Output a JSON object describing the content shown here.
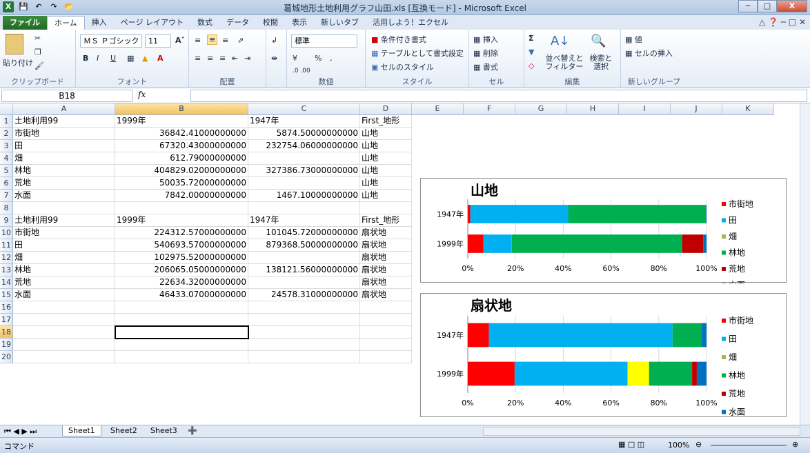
{
  "window": {
    "title": "葛城地形土地利用グラフ山田.xls [互換モード] - Microsoft Excel",
    "buttons": [
      "─",
      "□",
      "X"
    ]
  },
  "ribbon_tabs": [
    "ファイル",
    "ホーム",
    "挿入",
    "ページ レイアウト",
    "数式",
    "データ",
    "校閲",
    "表示",
    "新しいタブ",
    "活用しよう！エクセル"
  ],
  "ribbon": {
    "clipboard": {
      "paste": "貼り付け",
      "label": "クリップボード"
    },
    "font": {
      "name": "ＭＳ Ｐゴシック",
      "size": "11",
      "label": "フォント",
      "bold": "B",
      "italic": "I",
      "underline": "U"
    },
    "alignment": {
      "label": "配置"
    },
    "number": {
      "format": "標準",
      "percent": "%",
      "comma": ",",
      "label": "数値"
    },
    "styles": {
      "cond": "条件付き書式",
      "table": "テーブルとして書式設定",
      "cell": "セルのスタイル",
      "label": "スタイル"
    },
    "cells": {
      "insert": "挿入",
      "delete": "削除",
      "format": "書式",
      "label": "セル"
    },
    "editing": {
      "sigma": "Σ",
      "sort": "並べ替えと フィルター",
      "find": "検索と 選択",
      "label": "編集"
    },
    "custom": {
      "item1": "値",
      "item2": "セルの挿入",
      "label": "新しいグループ"
    }
  },
  "formula_bar": {
    "name_box": "B18",
    "fx": "fx",
    "value": ""
  },
  "columns": [
    "A",
    "B",
    "C",
    "D",
    "E",
    "F",
    "G",
    "H",
    "I",
    "J",
    "K"
  ],
  "rows": [
    "1",
    "2",
    "3",
    "4",
    "5",
    "6",
    "7",
    "8",
    "9",
    "10",
    "11",
    "12",
    "13",
    "14",
    "15",
    "16",
    "17",
    "18",
    "19",
    "20"
  ],
  "cells": [
    [
      "土地利用99",
      "1999年",
      "1947年",
      "First_地形"
    ],
    [
      "市街地",
      "36842.41000000000",
      "5874.50000000000",
      "山地"
    ],
    [
      "田",
      "67320.43000000000",
      "232754.06000000000",
      "山地"
    ],
    [
      "畑",
      "612.79000000000",
      "",
      "山地"
    ],
    [
      "林地",
      "404829.02000000000",
      "327386.73000000000",
      "山地"
    ],
    [
      "荒地",
      "50035.72000000000",
      "",
      "山地"
    ],
    [
      "水面",
      "7842.00000000000",
      "1467.10000000000",
      "山地"
    ],
    [
      "",
      "",
      "",
      ""
    ],
    [
      "土地利用99",
      "1999年",
      "1947年",
      "First_地形"
    ],
    [
      "市街地",
      "224312.57000000000",
      "101045.72000000000",
      "扇状地"
    ],
    [
      "田",
      "540693.57000000000",
      "879368.50000000000",
      "扇状地"
    ],
    [
      "畑",
      "102975.52000000000",
      "",
      "扇状地"
    ],
    [
      "林地",
      "206065.05000000000",
      "138121.56000000000",
      "扇状地"
    ],
    [
      "荒地",
      "22634.32000000000",
      "",
      "扇状地"
    ],
    [
      "水面",
      "46433.07000000000",
      "24578.31000000000",
      "扇状地"
    ]
  ],
  "chart_data": [
    {
      "type": "bar",
      "stacked": "100%",
      "title": "山地",
      "categories": [
        "1947年",
        "1999年"
      ],
      "series": [
        {
          "name": "市街地",
          "color": "#ff0000",
          "values": [
            5874.5,
            36842.41
          ]
        },
        {
          "name": "田",
          "color": "#00b0f0",
          "values": [
            232754.06,
            67320.43
          ]
        },
        {
          "name": "畑",
          "color": "#9bbb59",
          "values": [
            0,
            612.79
          ]
        },
        {
          "name": "林地",
          "color": "#00b050",
          "values": [
            327386.73,
            404829.02
          ]
        },
        {
          "name": "荒地",
          "color": "#c00000",
          "values": [
            0,
            50035.72
          ]
        },
        {
          "name": "水面",
          "color": "#0070c0",
          "values": [
            1467.1,
            7842.0
          ]
        }
      ],
      "xticks": [
        "0%",
        "20%",
        "40%",
        "60%",
        "80%",
        "100%"
      ],
      "legend": "right"
    },
    {
      "type": "bar",
      "stacked": "100%",
      "title": "扇状地",
      "categories": [
        "1947年",
        "1999年"
      ],
      "series": [
        {
          "name": "市街地",
          "color": "#ff0000",
          "values": [
            101045.72,
            224312.57
          ]
        },
        {
          "name": "田",
          "color": "#00b0f0",
          "values": [
            879368.5,
            540693.57
          ]
        },
        {
          "name": "畑",
          "color": "#ffff00",
          "values": [
            0,
            102975.52
          ]
        },
        {
          "name": "林地",
          "color": "#00b050",
          "values": [
            138121.56,
            206065.05
          ]
        },
        {
          "name": "荒地",
          "color": "#c00000",
          "values": [
            0,
            22634.32
          ]
        },
        {
          "name": "水面",
          "color": "#0070c0",
          "values": [
            24578.31,
            46433.07
          ]
        }
      ],
      "legend_colors": [
        "#ff0000",
        "#00b0f0",
        "#9bbb59",
        "#00b050",
        "#c00000",
        "#0070c0"
      ],
      "xticks": [
        "0%",
        "20%",
        "40%",
        "60%",
        "80%",
        "100%"
      ],
      "legend": "right"
    }
  ],
  "sheet_tabs": [
    "Sheet1",
    "Sheet2",
    "Sheet3"
  ],
  "status": {
    "mode": "コマンド",
    "zoom": "100%"
  }
}
